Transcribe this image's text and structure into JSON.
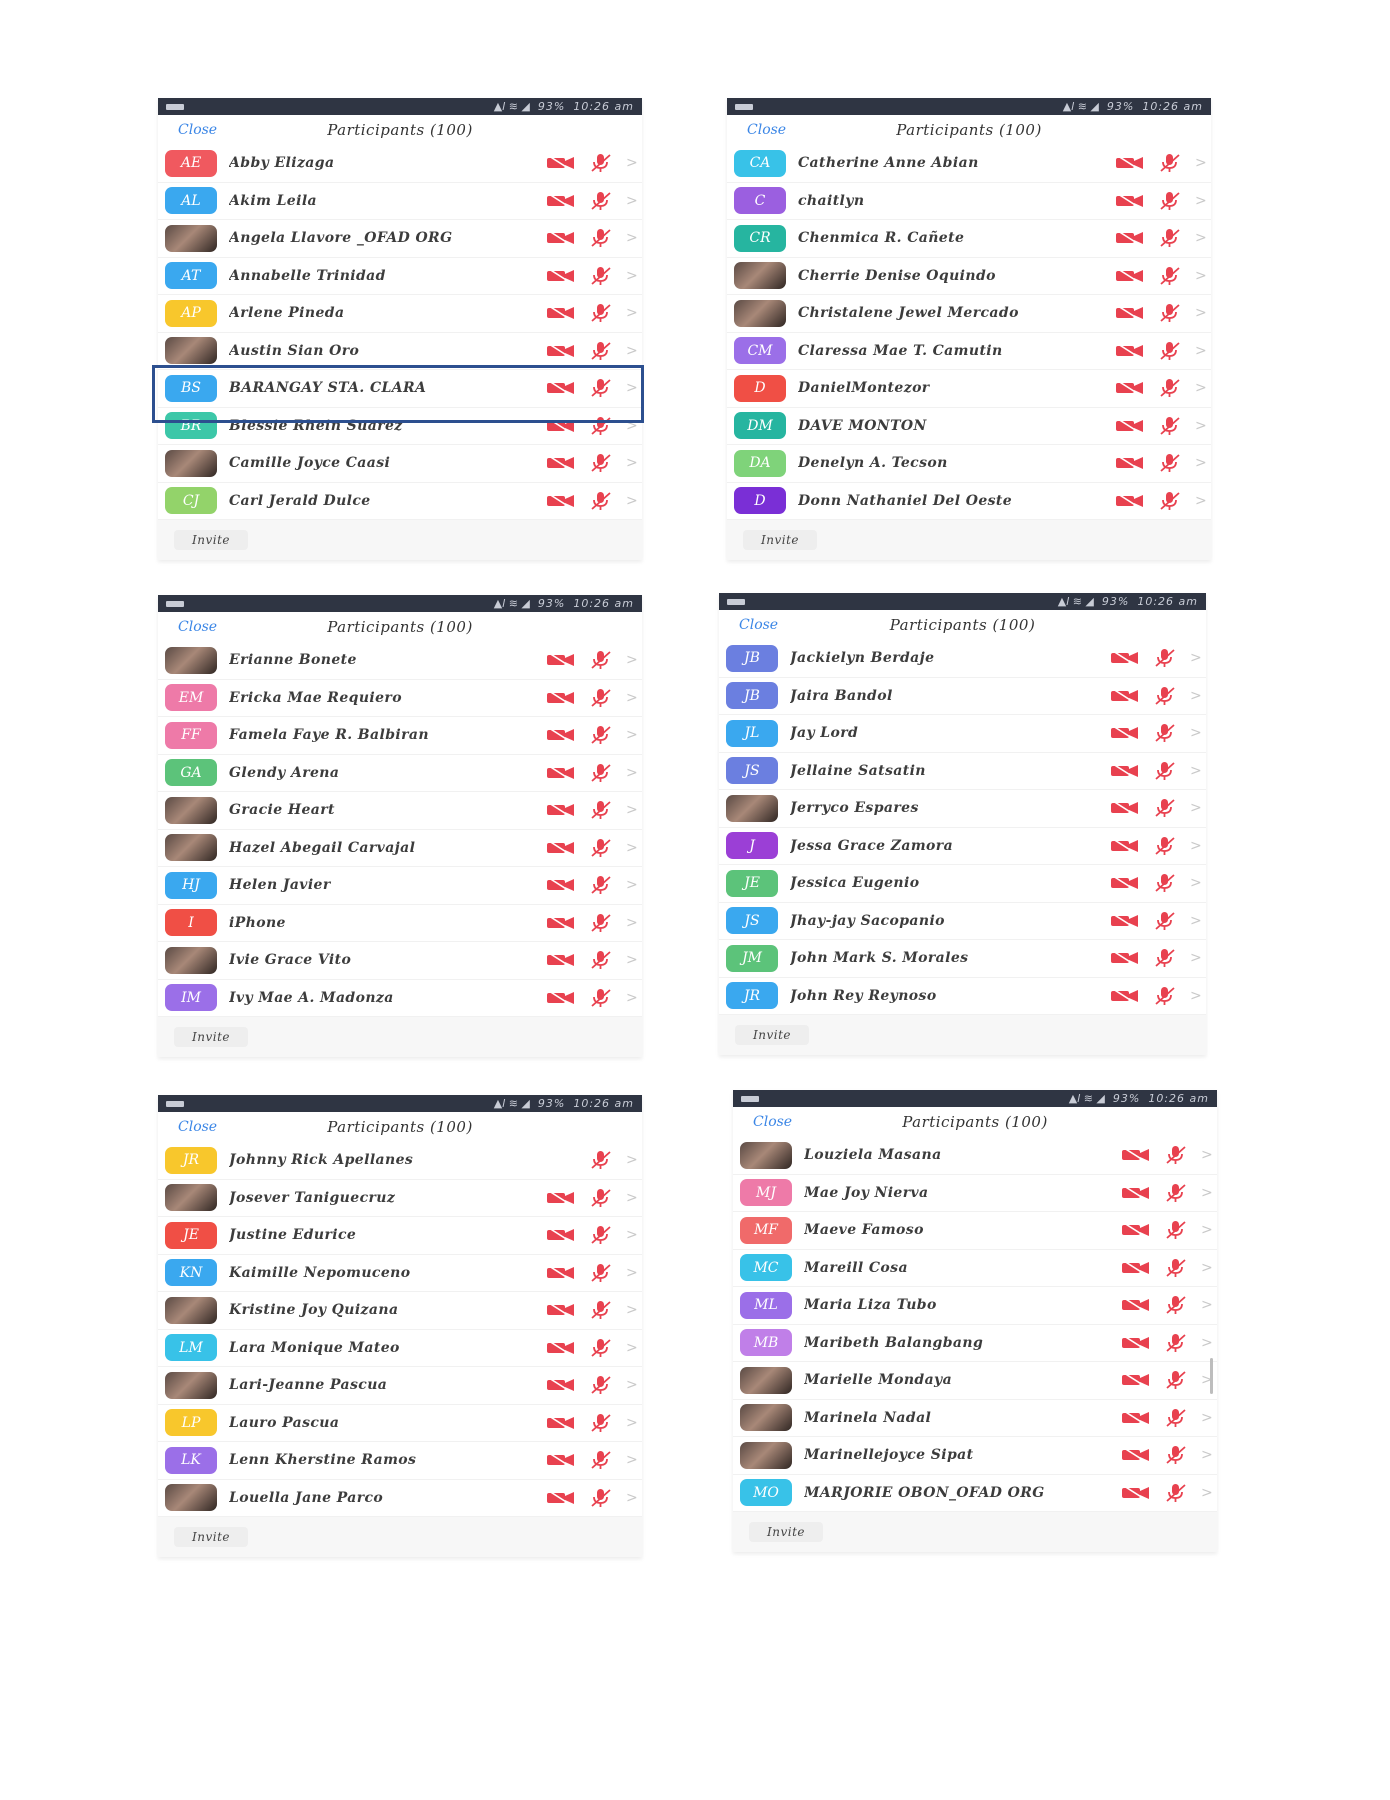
{
  "status_bar": {
    "signal": "▲l ≋ ◢",
    "battery": "93%",
    "time": "10:26 am"
  },
  "header": {
    "close_label": "Close",
    "title": "Participants (100)"
  },
  "footer": {
    "invite_label": "Invite"
  },
  "icons": {
    "video": "video-off-icon",
    "mic": "mic-off-icon",
    "chevron": "chevron-right-icon"
  },
  "colors": {
    "video_off": "#e8414f",
    "mic_off": "#e8414f",
    "status_bar": "#2f3543",
    "close_link": "#3b86e6",
    "highlight": "#2c4f8f"
  },
  "highlighted": {
    "panel": 0,
    "row": 6
  },
  "panels": [
    {
      "participants": [
        {
          "name": "Abby Elizaga",
          "initials": "AE",
          "color": "#f0595f"
        },
        {
          "name": "Akim Leila",
          "initials": "AL",
          "color": "#3aa8ef"
        },
        {
          "name": "Angela Llavore _OFAD ORG",
          "initials": "",
          "color": "",
          "photo": true
        },
        {
          "name": "Annabelle Trinidad",
          "initials": "AT",
          "color": "#3aa8ef"
        },
        {
          "name": "Arlene Pineda",
          "initials": "AP",
          "color": "#f8c72c"
        },
        {
          "name": "Austin Sian Oro",
          "initials": "",
          "color": "",
          "photo": true
        },
        {
          "name": "BARANGAY STA. CLARA",
          "initials": "BS",
          "color": "#3aa8ef"
        },
        {
          "name": "Blessie Rhein Suarez",
          "initials": "BR",
          "color": "#3cc7a8"
        },
        {
          "name": "Camille Joyce Caasi",
          "initials": "",
          "color": "",
          "photo": true
        },
        {
          "name": "Carl Jerald Dulce",
          "initials": "CJ",
          "color": "#93d36a"
        }
      ]
    },
    {
      "participants": [
        {
          "name": "Catherine Anne Abian",
          "initials": "CA",
          "color": "#38c2e8"
        },
        {
          "name": "chaitlyn",
          "initials": "C",
          "color": "#9b5fe0"
        },
        {
          "name": "Chenmica R. Cañete",
          "initials": "CR",
          "color": "#26b5a0"
        },
        {
          "name": "Cherrie Denise Oquindo",
          "initials": "",
          "color": "",
          "photo": true
        },
        {
          "name": "Christalene Jewel Mercado",
          "initials": "",
          "color": "",
          "photo": true
        },
        {
          "name": "Claressa Mae T. Camutin",
          "initials": "CM",
          "color": "#9b6fe8"
        },
        {
          "name": "DanielMontezor",
          "initials": "D",
          "color": "#f04f45"
        },
        {
          "name": "DAVE MONTON",
          "initials": "DM",
          "color": "#26b5a0"
        },
        {
          "name": "Denelyn A. Tecson",
          "initials": "DA",
          "color": "#7fd37a"
        },
        {
          "name": "Donn Nathaniel Del Oeste",
          "initials": "D",
          "color": "#7a2fd6"
        }
      ]
    },
    {
      "participants": [
        {
          "name": "Erianne Bonete",
          "initials": "",
          "color": "",
          "photo": true
        },
        {
          "name": "Ericka Mae Requiero",
          "initials": "EM",
          "color": "#ee7aa8"
        },
        {
          "name": "Famela Faye R. Balbiran",
          "initials": "FF",
          "color": "#ee7aa8"
        },
        {
          "name": "Glendy Arena",
          "initials": "GA",
          "color": "#5cc37a"
        },
        {
          "name": "Gracie Heart",
          "initials": "",
          "color": "",
          "photo": true
        },
        {
          "name": "Hazel Abegail Carvajal",
          "initials": "",
          "color": "",
          "photo": true
        },
        {
          "name": "Helen Javier",
          "initials": "HJ",
          "color": "#3aa8ef"
        },
        {
          "name": "iPhone",
          "initials": "I",
          "color": "#f04f45"
        },
        {
          "name": "Ivie Grace Vito",
          "initials": "",
          "color": "",
          "photo": true
        },
        {
          "name": "Ivy Mae A. Madonza",
          "initials": "IM",
          "color": "#9b6fe8"
        }
      ]
    },
    {
      "participants": [
        {
          "name": "Jackielyn Berdaje",
          "initials": "JB",
          "color": "#6b7fe0"
        },
        {
          "name": "Jaira Bandol",
          "initials": "JB",
          "color": "#6b7fe0"
        },
        {
          "name": "Jay Lord",
          "initials": "JL",
          "color": "#3aa8ef"
        },
        {
          "name": "Jellaine Satsatin",
          "initials": "JS",
          "color": "#6b7fe0"
        },
        {
          "name": "Jerryco Espares",
          "initials": "",
          "color": "",
          "photo": true
        },
        {
          "name": "Jessa Grace Zamora",
          "initials": "J",
          "color": "#9b3fd6"
        },
        {
          "name": "Jessica Eugenio",
          "initials": "JE",
          "color": "#5cc37a"
        },
        {
          "name": "Jhay-jay Sacopanio",
          "initials": "JS",
          "color": "#3aa8ef"
        },
        {
          "name": "John Mark S. Morales",
          "initials": "JM",
          "color": "#5cc37a"
        },
        {
          "name": "John Rey Reynoso",
          "initials": "JR",
          "color": "#3aa8ef"
        }
      ]
    },
    {
      "participants": [
        {
          "name": "Johnny Rick Apellanes",
          "initials": "JR",
          "color": "#f8c72c",
          "no_video": true
        },
        {
          "name": "Josever Taniguecruz",
          "initials": "",
          "color": "",
          "photo": true
        },
        {
          "name": "Justine Edurice",
          "initials": "JE",
          "color": "#f04f45"
        },
        {
          "name": "Kaimille Nepomuceno",
          "initials": "KN",
          "color": "#3aa8ef"
        },
        {
          "name": "Kristine Joy Quizana",
          "initials": "",
          "color": "",
          "photo": true
        },
        {
          "name": "Lara Monique Mateo",
          "initials": "LM",
          "color": "#38c2e8"
        },
        {
          "name": "Lari-Jeanne Pascua",
          "initials": "",
          "color": "",
          "photo": true
        },
        {
          "name": "Lauro Pascua",
          "initials": "LP",
          "color": "#f8c72c"
        },
        {
          "name": "Lenn Kherstine Ramos",
          "initials": "LK",
          "color": "#9b6fe8"
        },
        {
          "name": "Louella Jane Parco",
          "initials": "",
          "color": "",
          "photo": true
        }
      ]
    },
    {
      "participants": [
        {
          "name": "Louziela Masana",
          "initials": "",
          "color": "",
          "photo": true
        },
        {
          "name": "Mae Joy Nierva",
          "initials": "MJ",
          "color": "#ee7aa8"
        },
        {
          "name": "Maeve Famoso",
          "initials": "MF",
          "color": "#f06a6a"
        },
        {
          "name": "Mareill Cosa",
          "initials": "MC",
          "color": "#38c2e8"
        },
        {
          "name": "Maria Liza Tubo",
          "initials": "ML",
          "color": "#9b6fe8"
        },
        {
          "name": "Maribeth Balangbang",
          "initials": "MB",
          "color": "#c07fe8"
        },
        {
          "name": "Marielle Mondaya",
          "initials": "",
          "color": "",
          "photo": true
        },
        {
          "name": "Marinela Nadal",
          "initials": "",
          "color": "",
          "photo": true
        },
        {
          "name": "Marinellejoyce Sipat",
          "initials": "",
          "color": "",
          "photo": true
        },
        {
          "name": "MARJORIE OBON_OFAD ORG",
          "initials": "MO",
          "color": "#38c2e8"
        }
      ]
    }
  ]
}
